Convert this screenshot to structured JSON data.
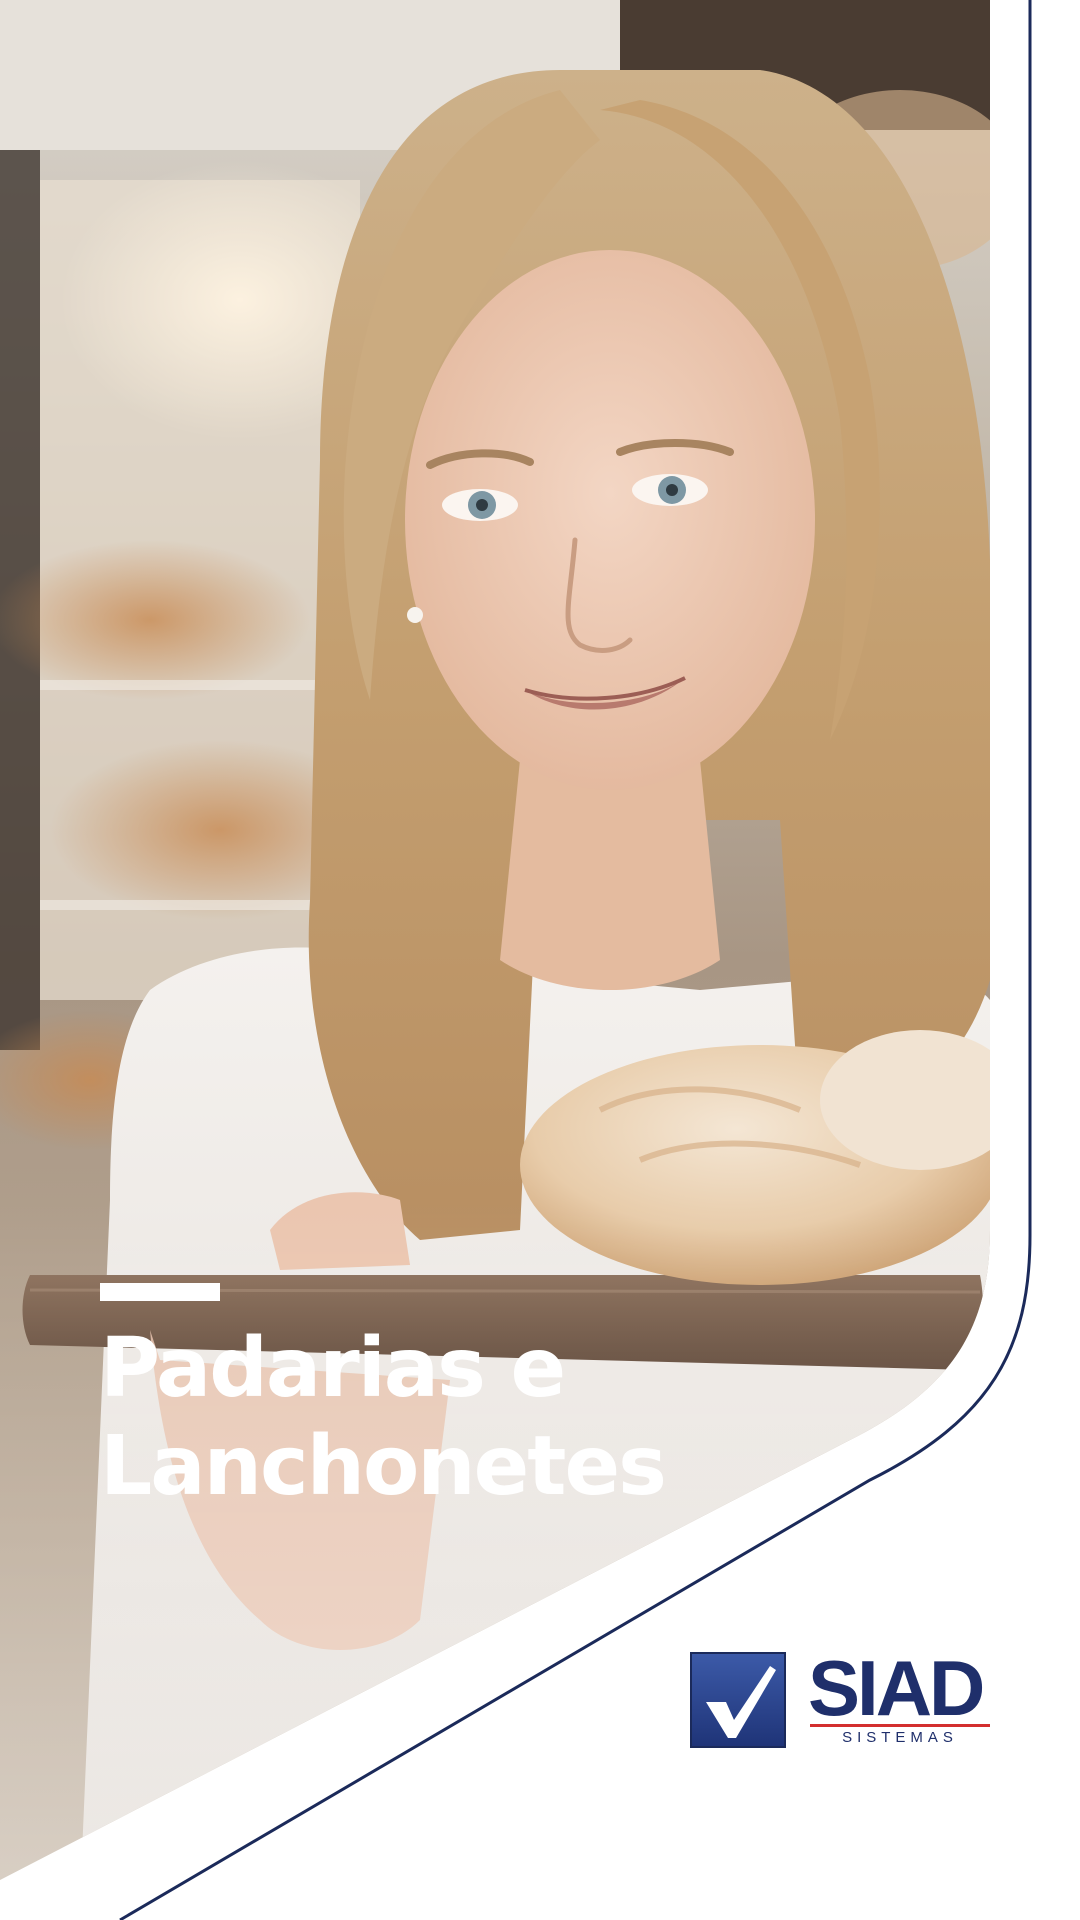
{
  "headline": {
    "line1": "Padarias e",
    "line2": "Lanchonetes"
  },
  "brand": {
    "name": "SIAD",
    "tagline": "SISTEMAS",
    "primary_color": "#1f2f6b",
    "accent_color": "#d32f2f",
    "icon": "checkmark-icon"
  },
  "colors": {
    "page_background": "#ffffff",
    "border_curve": "#1b2a5a",
    "headline_text": "#ffffff"
  }
}
